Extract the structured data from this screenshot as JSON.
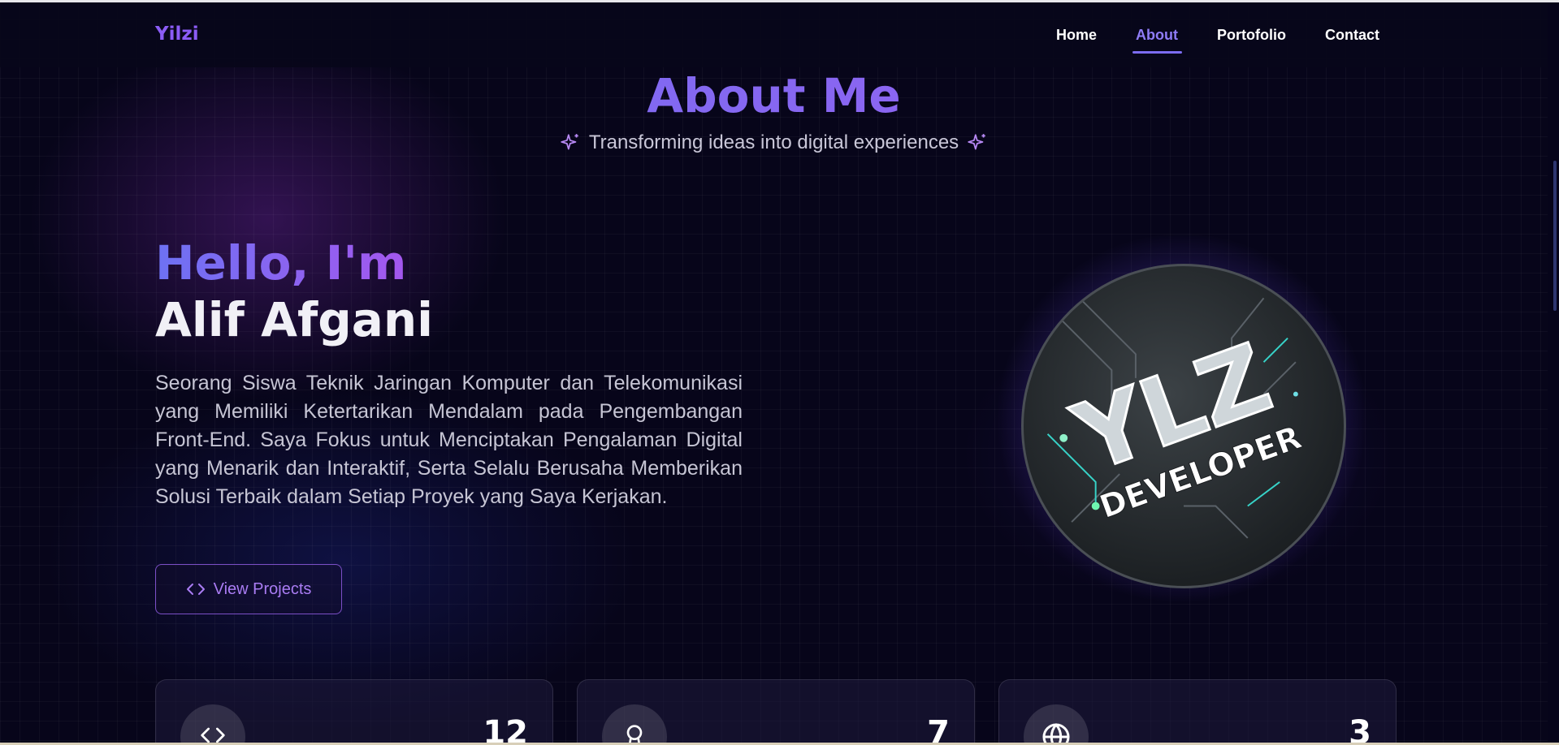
{
  "nav": {
    "logo": "Yilzi",
    "links": [
      {
        "label": "Home",
        "active": false
      },
      {
        "label": "About",
        "active": true
      },
      {
        "label": "Portofolio",
        "active": false
      },
      {
        "label": "Contact",
        "active": false
      }
    ]
  },
  "header": {
    "title": "About Me",
    "subtitle": "Transforming ideas into digital experiences"
  },
  "intro": {
    "greeting": "Hello, I'm",
    "name": "Alif Afgani",
    "description": "Seorang Siswa Teknik Jaringan Komputer dan Telekomunikasi yang Memiliki Ketertarikan Mendalam pada Pengembangan Front-End. Saya Fokus untuk Menciptakan Pengalaman Digital yang Menarik dan Interaktif, Serta Selalu Berusaha Memberikan Solusi Terbaik dalam Setiap Proyek yang Saya Kerjakan.",
    "button_label": "View Projects"
  },
  "avatar": {
    "logo_text": "YLZ",
    "caption": "DEVELOPER"
  },
  "stats": [
    {
      "icon": "code-icon",
      "value": "12"
    },
    {
      "icon": "award-icon",
      "value": "7"
    },
    {
      "icon": "globe-icon",
      "value": "3"
    }
  ],
  "colors": {
    "accent": "#8b5cf6",
    "gradient_start": "#6b72f2",
    "gradient_end": "#a15cf0",
    "background": "#07051a"
  }
}
